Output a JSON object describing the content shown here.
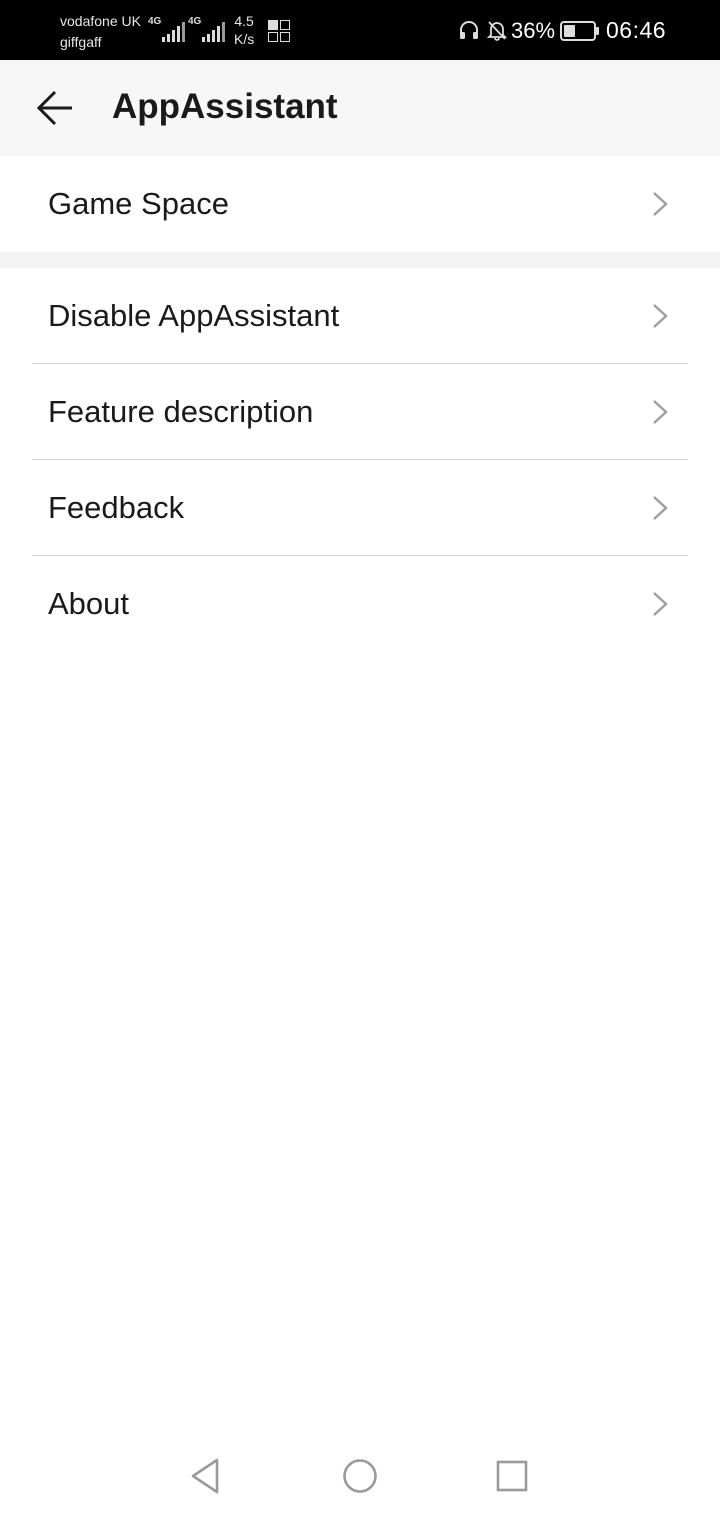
{
  "status_bar": {
    "carrier_1": "vodafone UK",
    "carrier_2": "giffgaff",
    "network_1": "4G",
    "network_2": "4G",
    "speed_value": "4.5",
    "speed_unit": "K/s",
    "battery_percent": "36%",
    "time": "06:46"
  },
  "app_bar": {
    "title": "AppAssistant",
    "back_icon": "arrow-left-icon"
  },
  "menu": {
    "items": [
      {
        "label": "Game Space",
        "icon": "chevron-right-icon"
      },
      {
        "label": "Disable AppAssistant",
        "icon": "chevron-right-icon"
      },
      {
        "label": "Feature description",
        "icon": "chevron-right-icon"
      },
      {
        "label": "Feedback",
        "icon": "chevron-right-icon"
      },
      {
        "label": "About",
        "icon": "chevron-right-icon"
      }
    ]
  },
  "nav_bar": {
    "back_icon": "triangle-back-icon",
    "home_icon": "circle-home-icon",
    "recents_icon": "square-recents-icon"
  },
  "colors": {
    "status_bar_bg": "#000000",
    "app_bar_bg": "#f7f7f7",
    "text": "#1a1a1a",
    "chevron": "#9e9e9e",
    "divider": "#d6d6d6"
  }
}
